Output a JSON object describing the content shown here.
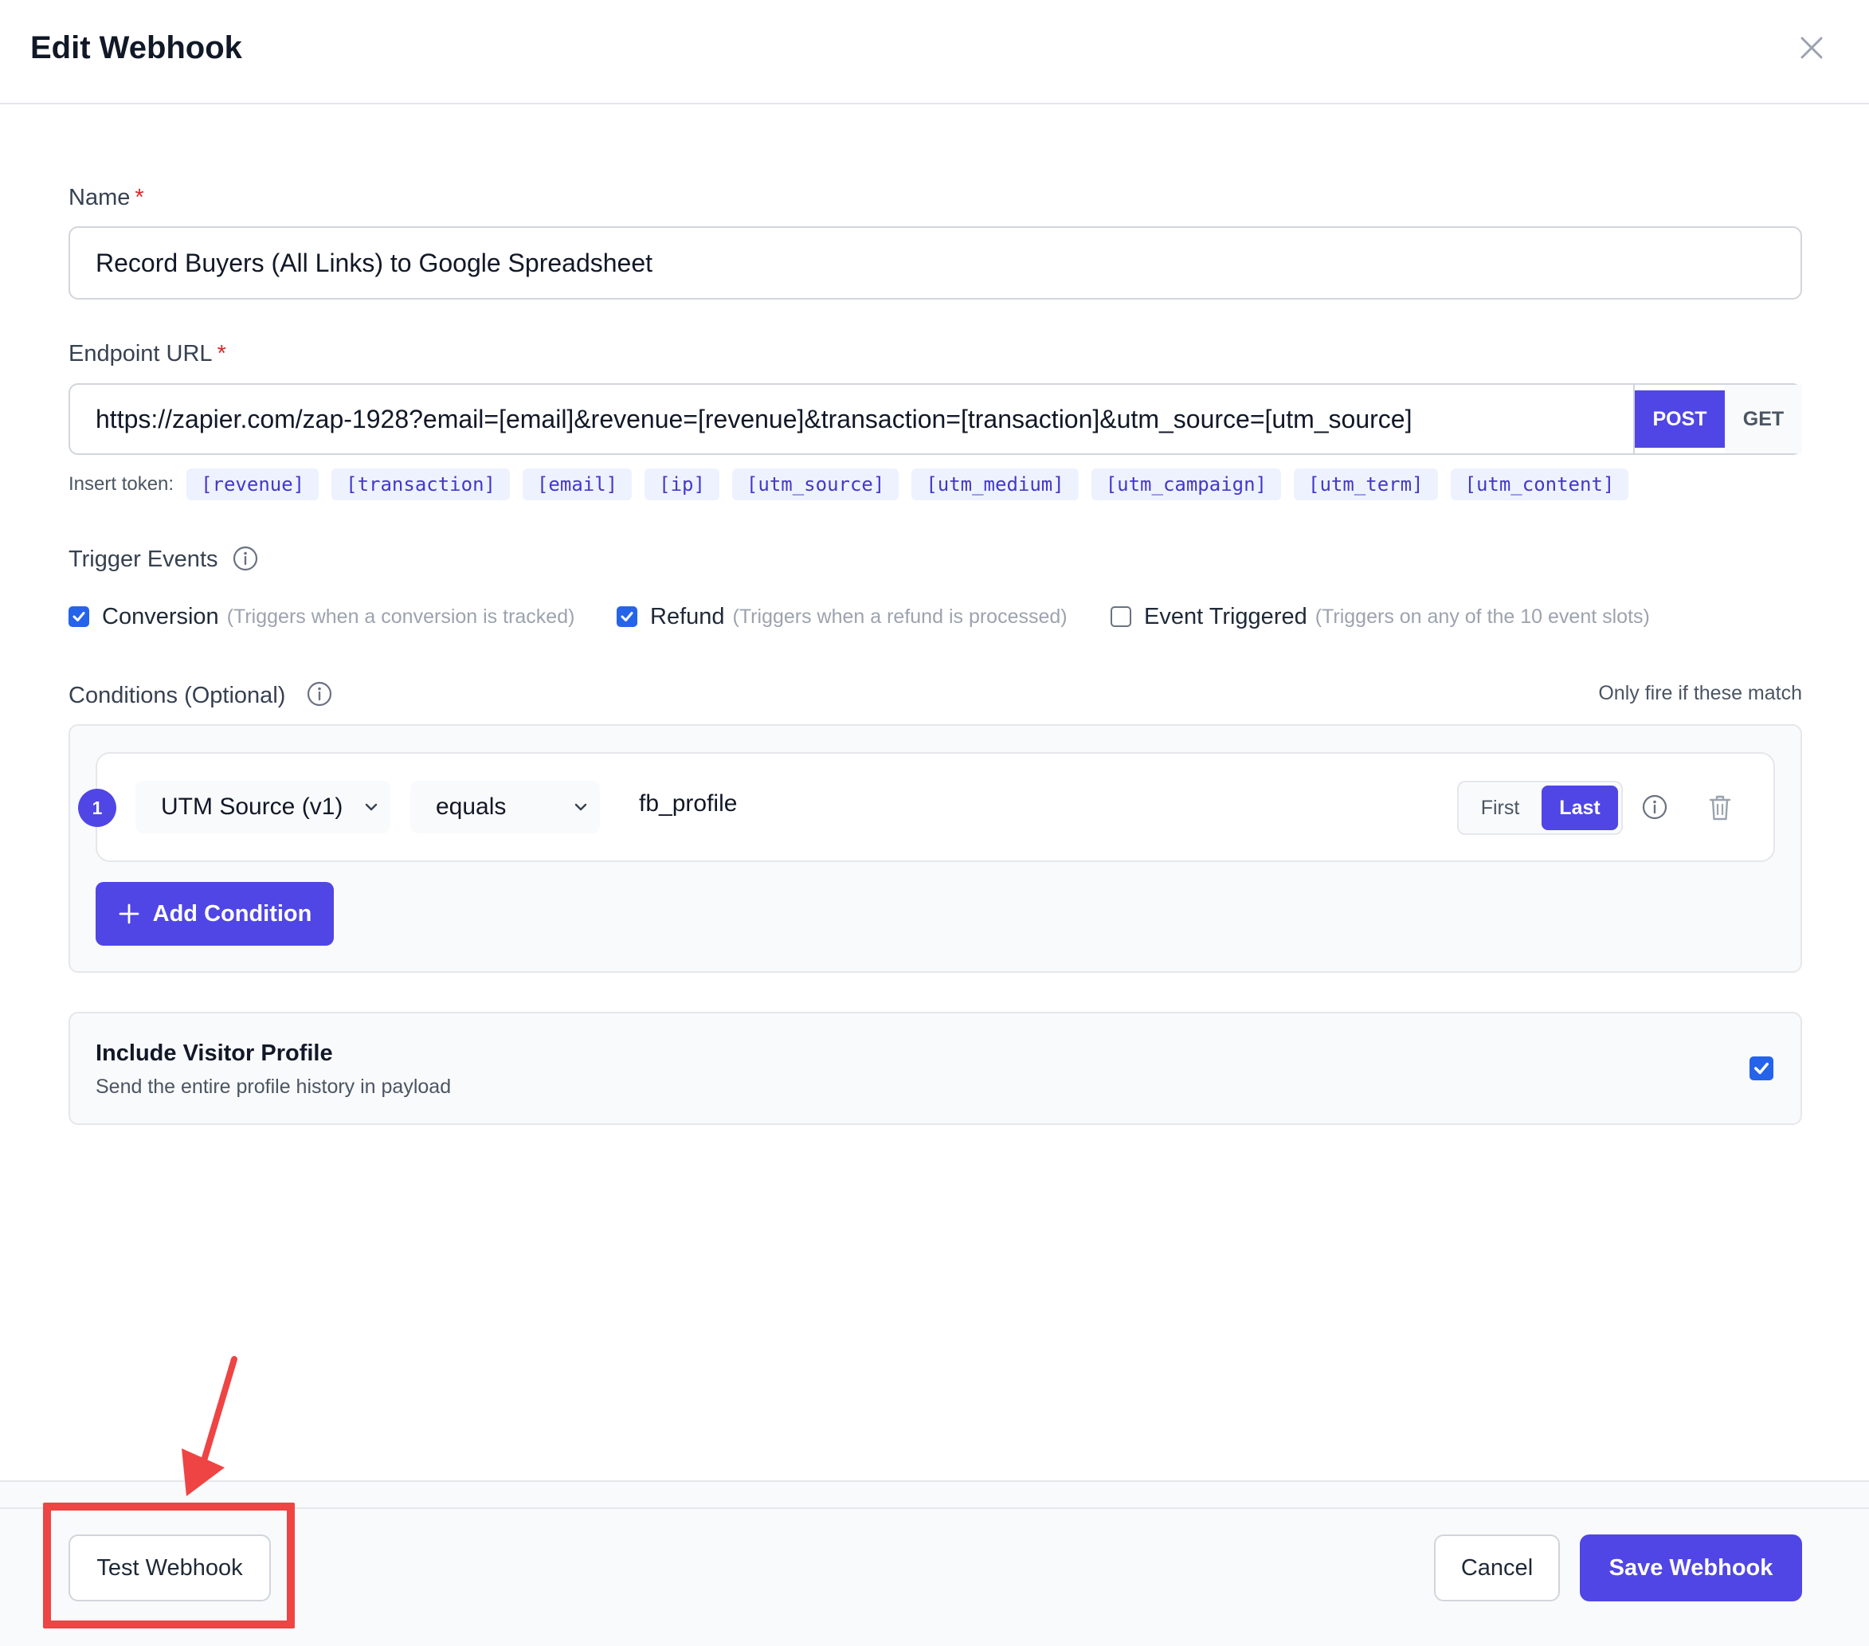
{
  "dialog": {
    "title": "Edit Webhook"
  },
  "name_field": {
    "label": "Name",
    "required_mark": "*",
    "value": "Record Buyers (All Links) to Google Spreadsheet"
  },
  "endpoint_field": {
    "label": "Endpoint URL",
    "required_mark": "*",
    "value": "https://zapier.com/zap-1928?email=[email]&revenue=[revenue]&transaction=[transaction]&utm_source=[utm_source]",
    "methods": [
      {
        "label": "POST",
        "selected": true
      },
      {
        "label": "GET",
        "selected": false
      }
    ]
  },
  "tokens": {
    "label": "Insert token:",
    "items": [
      "[revenue]",
      "[transaction]",
      "[email]",
      "[ip]",
      "[utm_source]",
      "[utm_medium]",
      "[utm_campaign]",
      "[utm_term]",
      "[utm_content]"
    ]
  },
  "triggers": {
    "label": "Trigger Events",
    "items": [
      {
        "name": "Conversion",
        "desc": "(Triggers when a conversion is tracked)",
        "checked": true
      },
      {
        "name": "Refund",
        "desc": "(Triggers when a refund is processed)",
        "checked": true
      },
      {
        "name": "Event Triggered",
        "desc": "(Triggers on any of the 10 event slots)",
        "checked": false
      }
    ]
  },
  "conditions": {
    "label": "Conditions (Optional)",
    "hint": "Only fire if these match",
    "rows": [
      {
        "number": "1",
        "field": "UTM Source (v1)",
        "operator": "equals",
        "value": "fb_profile",
        "first_label": "First",
        "last_label": "Last",
        "touch": "Last"
      }
    ],
    "add_label": "Add Condition"
  },
  "visitor_profile": {
    "title": "Include Visitor Profile",
    "desc": "Send the entire profile history in payload",
    "checked": true
  },
  "footer": {
    "test_label": "Test Webhook",
    "cancel_label": "Cancel",
    "save_label": "Save Webhook"
  },
  "colors": {
    "accent": "#4f46e5",
    "checkbox": "#2563eb",
    "annotation": "#ef4444",
    "required": "#dc2626"
  }
}
